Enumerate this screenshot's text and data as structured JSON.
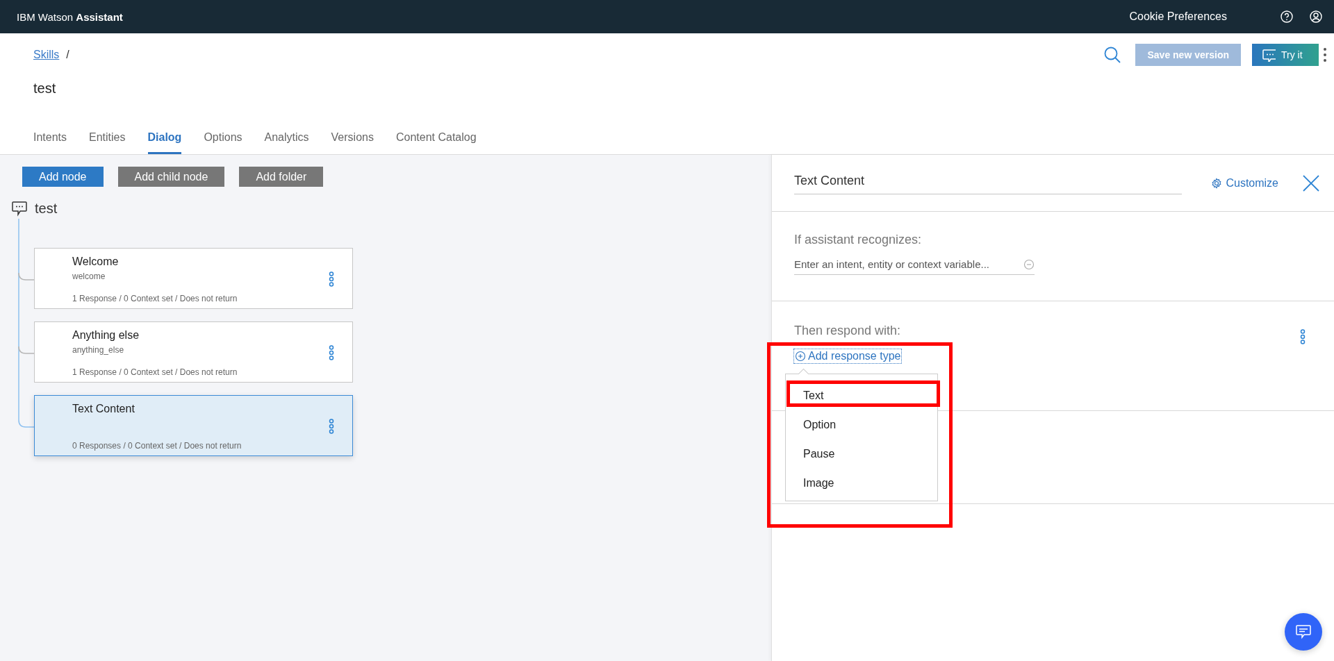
{
  "top_bar": {
    "product": "IBM Watson **Assistant**",
    "cookie_link": "Cookie Preferences"
  },
  "header": {
    "breadcrumb": {
      "link": "Skills",
      "separator": "/"
    },
    "title": "test",
    "save_button": {
      "label": "Save new version",
      "disabled": true
    },
    "try_button": {
      "label": "Try it"
    }
  },
  "tabs": [
    {
      "label": "Intents",
      "selected": false
    },
    {
      "label": "Entities",
      "selected": false
    },
    {
      "label": "Dialog",
      "selected": true
    },
    {
      "label": "Options",
      "selected": false
    },
    {
      "label": "Analytics",
      "selected": false
    },
    {
      "label": "Versions",
      "selected": false
    },
    {
      "label": "Content Catalog",
      "selected": false
    }
  ],
  "toolbar": [
    {
      "label": "Add node",
      "kind": "primary"
    },
    {
      "label": "Add child node",
      "kind": "secondary"
    },
    {
      "label": "Add folder",
      "kind": "secondary"
    }
  ],
  "tree": {
    "root": "test",
    "children": [
      {
        "title": "Welcome",
        "condition": "welcome",
        "summary": "1 Response / 0 Context set / Does not return",
        "selected": false
      },
      {
        "title": "Anything else",
        "condition": "anything_else",
        "summary": "1 Response / 0 Context set / Does not return",
        "selected": false
      },
      {
        "title": "Text Content",
        "summary": "0 Responses / 0 Context set / Does not return",
        "selected": true
      }
    ]
  },
  "editor": {
    "node_name": "Text Content",
    "customize": "Customize",
    "condition_label": "If assistant recognizes:",
    "condition_placeholder": "Enter an intent, entity or context variable...",
    "response_label": "Then respond with:",
    "add_response": "Add response type",
    "response_menu": [
      "Text",
      "Option",
      "Pause",
      "Image"
    ]
  }
}
